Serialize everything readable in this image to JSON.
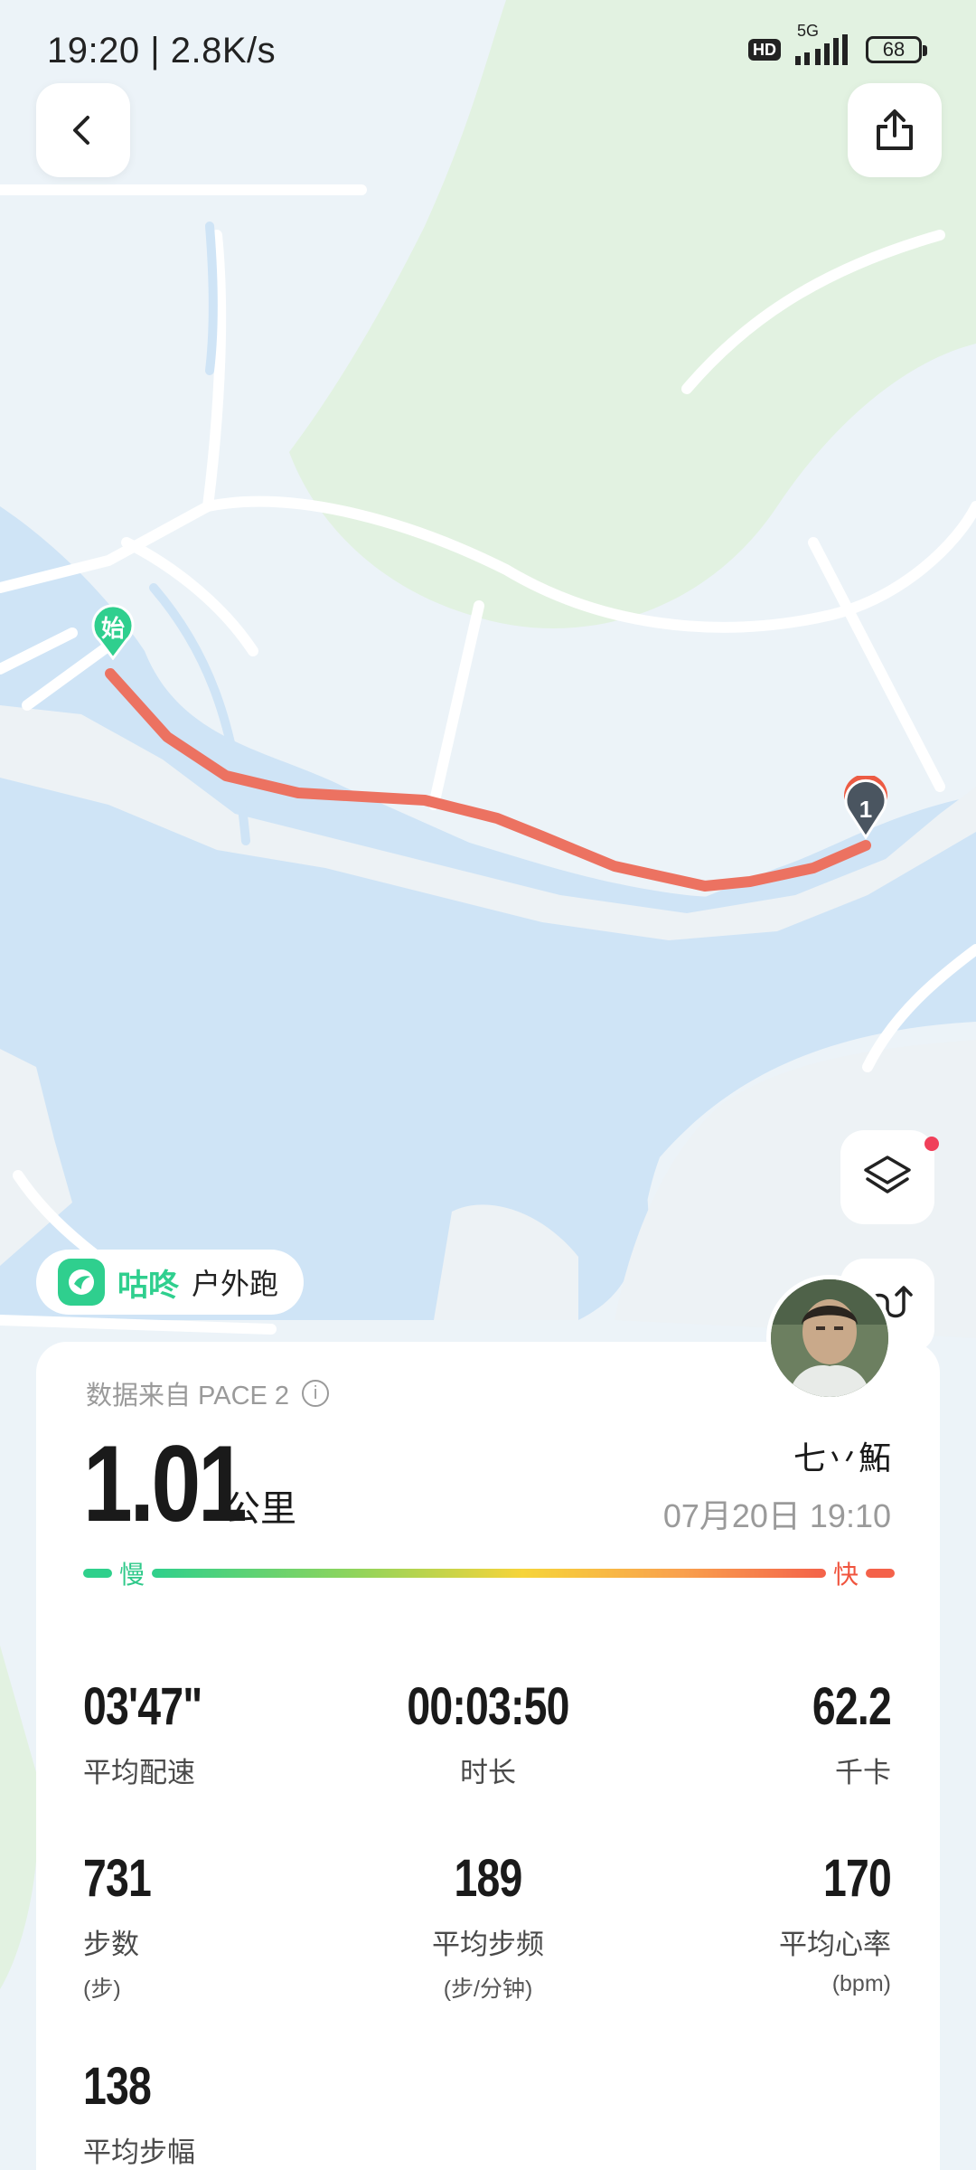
{
  "status": {
    "time": "19:20",
    "speed": "2.8K/s",
    "hd": "HD",
    "network": "5G",
    "battery": "68"
  },
  "map": {
    "start_marker": "始",
    "end_marker": "1",
    "route_color": "#ec7261"
  },
  "brand": {
    "name": "咕咚",
    "activity": "户外跑",
    "accent": "#2fcf8e"
  },
  "summary": {
    "source": "数据来自 PACE 2",
    "distance": "1.01",
    "distance_unit": "公里",
    "user_name": "七丷鮖",
    "date": "07月20日 19:10",
    "slow_label": "慢",
    "fast_label": "快"
  },
  "stats": [
    {
      "value": "03'47\"",
      "label": "平均配速",
      "sub": ""
    },
    {
      "value": "00:03:50",
      "label": "时长",
      "sub": ""
    },
    {
      "value": "62.2",
      "label": "千卡",
      "sub": ""
    },
    {
      "value": "731",
      "label": "步数",
      "sub": "(步)"
    },
    {
      "value": "189",
      "label": "平均步频",
      "sub": "(步/分钟)"
    },
    {
      "value": "170",
      "label": "平均心率",
      "sub": "(bpm)"
    },
    {
      "value": "138",
      "label": "平均步幅",
      "sub": ""
    }
  ],
  "icons": {
    "back": "back-icon",
    "share": "share-icon",
    "layers": "layers-icon",
    "route": "route-icon",
    "info": "info-icon"
  }
}
